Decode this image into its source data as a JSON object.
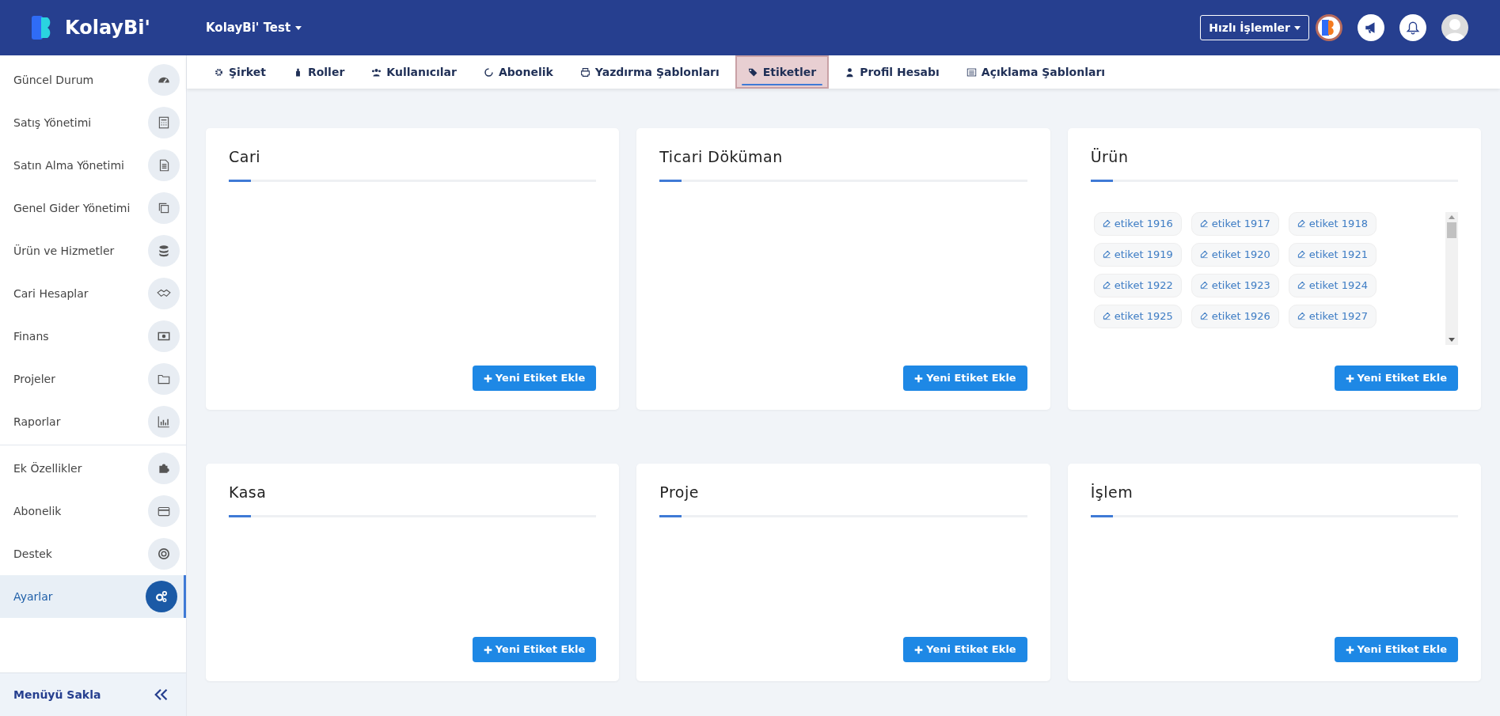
{
  "header": {
    "logo_text": "KolayBi'",
    "company": "KolayBi' Test",
    "quick_actions": "Hızlı İşlemler"
  },
  "sidebar": {
    "items": [
      {
        "label": "Güncel Durum",
        "selected": false
      },
      {
        "label": "Satış Yönetimi",
        "selected": false
      },
      {
        "label": "Satın Alma Yönetimi",
        "selected": false
      },
      {
        "label": "Genel Gider Yönetimi",
        "selected": false
      },
      {
        "label": "Ürün ve Hizmetler",
        "selected": false
      },
      {
        "label": "Cari Hesaplar",
        "selected": false
      },
      {
        "label": "Finans",
        "selected": false
      },
      {
        "label": "Projeler",
        "selected": false
      },
      {
        "label": "Raporlar",
        "selected": false
      },
      {
        "label": "Ek Özellikler",
        "selected": false
      },
      {
        "label": "Abonelik",
        "selected": false
      },
      {
        "label": "Destek",
        "selected": false
      },
      {
        "label": "Ayarlar",
        "selected": true
      }
    ],
    "collapse": "Menüyü Sakla"
  },
  "tabs": [
    {
      "label": "Şirket",
      "selected": false
    },
    {
      "label": "Roller",
      "selected": false
    },
    {
      "label": "Kullanıcılar",
      "selected": false
    },
    {
      "label": "Abonelik",
      "selected": false
    },
    {
      "label": "Yazdırma Şablonları",
      "selected": false
    },
    {
      "label": "Etiketler",
      "selected": true
    },
    {
      "label": "Profil Hesabı",
      "selected": false
    },
    {
      "label": "Açıklama Şablonları",
      "selected": false
    }
  ],
  "cards": [
    {
      "title": "Cari",
      "button": "Yeni Etiket Ekle"
    },
    {
      "title": "Ticari Döküman",
      "button": "Yeni Etiket Ekle"
    },
    {
      "title": "Ürün",
      "tags": [
        "etiket 1916",
        "etiket 1917",
        "etiket 1918",
        "etiket 1919",
        "etiket 1920",
        "etiket 1921",
        "etiket 1922",
        "etiket 1923",
        "etiket 1924",
        "etiket 1925",
        "etiket 1926",
        "etiket 1927"
      ],
      "button": "Yeni Etiket Ekle"
    },
    {
      "title": "Kasa",
      "button": "Yeni Etiket Ekle"
    },
    {
      "title": "Proje",
      "button": "Yeni Etiket Ekle"
    },
    {
      "title": "İşlem",
      "button": "Yeni Etiket Ekle"
    }
  ]
}
